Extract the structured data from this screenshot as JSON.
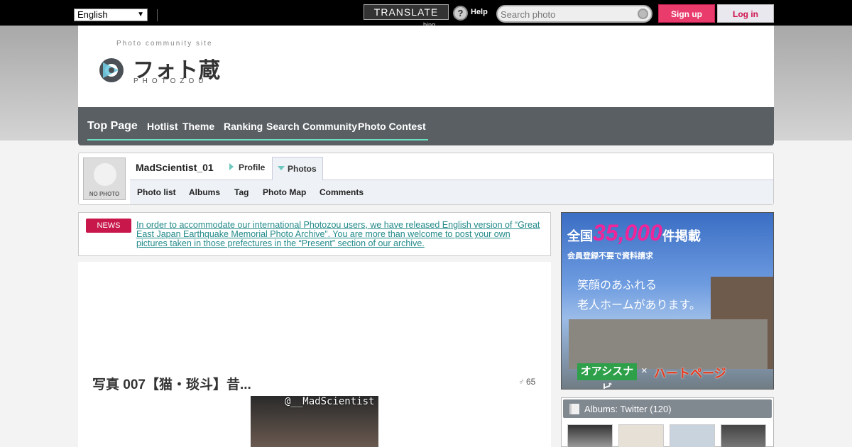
{
  "topbar": {
    "language": "English",
    "translate_label": "TRANSLATE",
    "bing_label": "bing",
    "help_icon": "help-icon",
    "help_label": "Help",
    "search_placeholder": "Search photo",
    "signup_label": "Sign up",
    "login_label": "Log in"
  },
  "logo": {
    "tagline": "Photo community site",
    "name": "フォト蔵",
    "sub": "PHOTOZOU"
  },
  "nav": {
    "items": [
      "Top Page",
      "Hotlist",
      "Theme",
      "Ranking",
      "Search",
      "Community",
      "Photo Contest"
    ]
  },
  "user": {
    "avatar_text": "NO PHOTO",
    "name": "MadScientist_01",
    "tab_profile": "Profile",
    "tab_photos": "Photos",
    "sub_links": [
      "Photo list",
      "Albums",
      "Tag",
      "Photo Map",
      "Comments"
    ]
  },
  "news": {
    "badge": "NEWS",
    "text": "In order to accommodate our international Photozou users, we have released English version of “Great East Japan Earthquake Memorial Photo Archive”. You are more than welcome to post your own pictures taken in those prefectures in the “Present” section of our archive."
  },
  "photo": {
    "title": "写真 007【猫・琰斗】昔...",
    "views": "65",
    "watermark": "@__MadScientist"
  },
  "ad": {
    "headline_pre": "全国",
    "headline_num": "35,000",
    "headline_post": "件掲載",
    "sub": "会員登録不要で資料請求",
    "line1": "笑顔のあふれる",
    "line2": "老人ホームがあります。",
    "brand1": "オアシスナビ",
    "brand_x": "×",
    "brand2": "ハートページ"
  },
  "albums": {
    "title": "Albums: Twitter",
    "count": "(120)"
  },
  "colors": {
    "accent_pink": "#e93c6c",
    "nav_bg": "#5a5f63",
    "nav_underline": "#6de0c2",
    "news_link": "#238a8a",
    "news_badge": "#c8174a"
  }
}
